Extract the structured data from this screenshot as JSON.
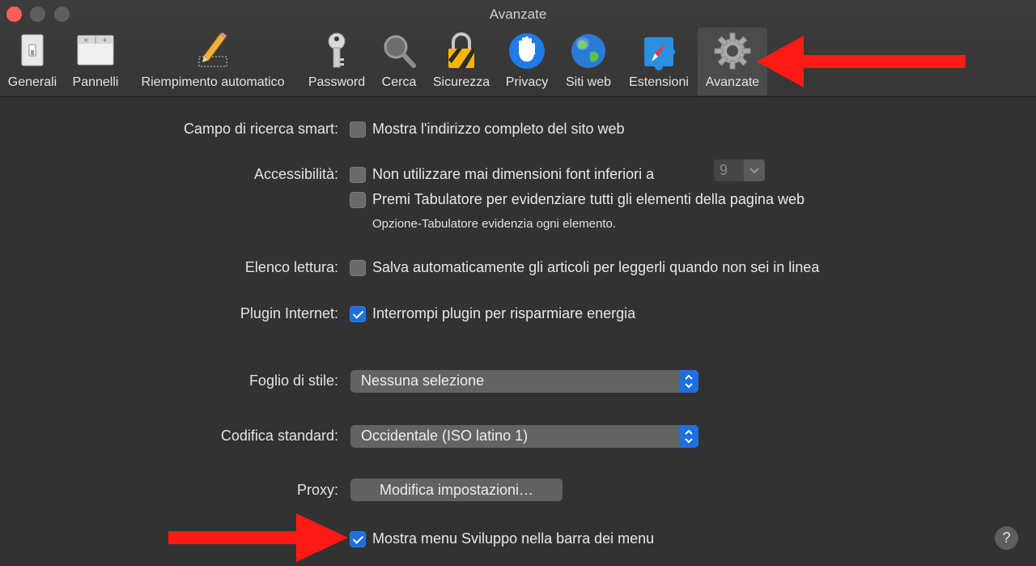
{
  "window": {
    "title": "Avanzate"
  },
  "toolbar": {
    "items": [
      {
        "label": "Generali",
        "icon": "switch-icon"
      },
      {
        "label": "Pannelli",
        "icon": "tabs-icon"
      },
      {
        "label": "Riempimento automatico",
        "icon": "pencil-icon"
      },
      {
        "label": "Password",
        "icon": "key-icon"
      },
      {
        "label": "Cerca",
        "icon": "magnifier-icon"
      },
      {
        "label": "Sicurezza",
        "icon": "lock-icon"
      },
      {
        "label": "Privacy",
        "icon": "hand-icon"
      },
      {
        "label": "Siti web",
        "icon": "globe-icon"
      },
      {
        "label": "Estensioni",
        "icon": "puzzle-icon"
      },
      {
        "label": "Avanzate",
        "icon": "gear-icon",
        "selected": true
      }
    ]
  },
  "settings": {
    "smart_search": {
      "label": "Campo di ricerca smart:",
      "option": "Mostra l'indirizzo completo del sito web",
      "checked": false
    },
    "accessibility": {
      "label": "Accessibilità:",
      "option1": "Non utilizzare mai dimensioni font inferiori a",
      "option1_checked": false,
      "font_size": "9",
      "option2": "Premi Tabulatore per evidenziare tutti gli elementi della pagina web",
      "option2_checked": false,
      "hint": "Opzione-Tabulatore evidenzia ogni elemento."
    },
    "reading_list": {
      "label": "Elenco lettura:",
      "option": "Salva automaticamente gli articoli per leggerli quando non sei in linea",
      "checked": false
    },
    "plugins": {
      "label": "Plugin Internet:",
      "option": "Interrompi plugin per risparmiare energia",
      "checked": true
    },
    "stylesheet": {
      "label": "Foglio di stile:",
      "value": "Nessuna selezione"
    },
    "encoding": {
      "label": "Codifica standard:",
      "value": "Occidentale (ISO latino 1)"
    },
    "proxy": {
      "label": "Proxy:",
      "button": "Modifica impostazioni…"
    },
    "develop_menu": {
      "option": "Mostra menu Sviluppo nella barra dei menu",
      "checked": true
    }
  },
  "help": {
    "label": "?"
  },
  "colors": {
    "accent": "#1f6fe0",
    "annotation_arrow": "#ff1a14",
    "background": "#323232"
  }
}
